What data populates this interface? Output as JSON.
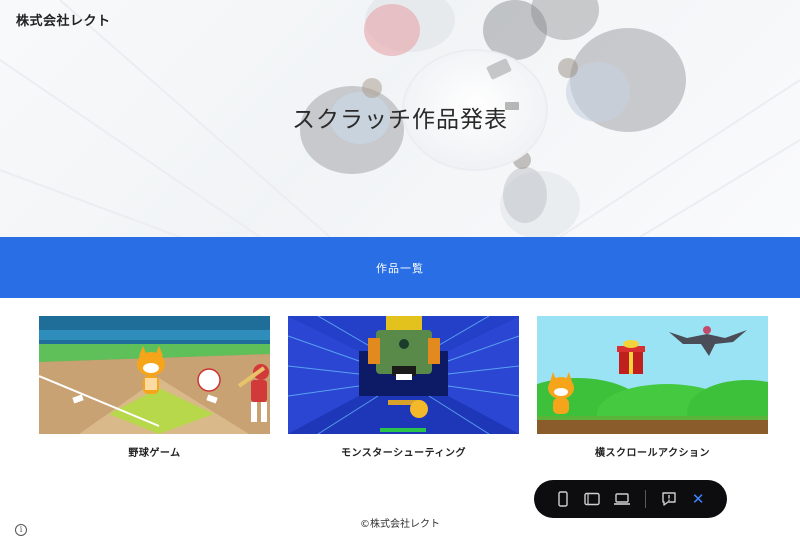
{
  "header": {
    "logo_text": "株式会社レクト"
  },
  "hero": {
    "title": "スクラッチ作品発表"
  },
  "section": {
    "title": "作品一覧"
  },
  "works": [
    {
      "caption": "野球ゲーム"
    },
    {
      "caption": "モンスターシューティング"
    },
    {
      "caption": "横スクロールアクション"
    }
  ],
  "footer": {
    "copyright": "©株式会社レクト"
  },
  "toolbar": {
    "icons": [
      "phone-icon",
      "tablet-icon",
      "laptop-icon",
      "comment-icon",
      "close-icon"
    ],
    "close_glyph": "✕"
  },
  "colors": {
    "band": "#2a6ee5",
    "toolbar_bg": "#0d0d10",
    "close_accent": "#3b86ff"
  }
}
